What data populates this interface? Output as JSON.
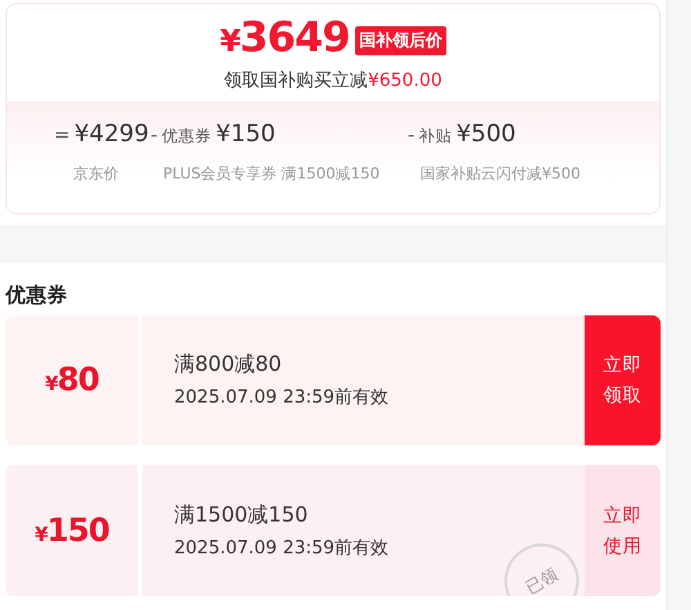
{
  "price_card": {
    "currency": "¥",
    "price": "3649",
    "badge": "国补领后价",
    "saving_text": "领取国补购买立减",
    "saving_amount": "¥650.00",
    "breakdown": [
      {
        "operator": "=",
        "amount": "¥4299",
        "note": "京东价"
      },
      {
        "operator": "-",
        "label": "优惠券",
        "amount": "¥150",
        "note": "PLUS会员专享券 满1500减150"
      },
      {
        "operator": "-",
        "label": "补贴",
        "amount": "¥500",
        "note": "国家补贴云闪付减¥500"
      }
    ]
  },
  "coupons_title": "优惠券",
  "coupons": [
    {
      "currency": "¥",
      "amount": "80",
      "condition": "满800减80",
      "validity": "2025.07.09 23:59前有效",
      "action": "立即领取",
      "claimed": false
    },
    {
      "currency": "¥",
      "amount": "150",
      "condition": "满1500减150",
      "validity": "2025.07.09 23:59前有效",
      "action": "立即使用",
      "claimed": true,
      "stamp": "已领"
    }
  ]
}
